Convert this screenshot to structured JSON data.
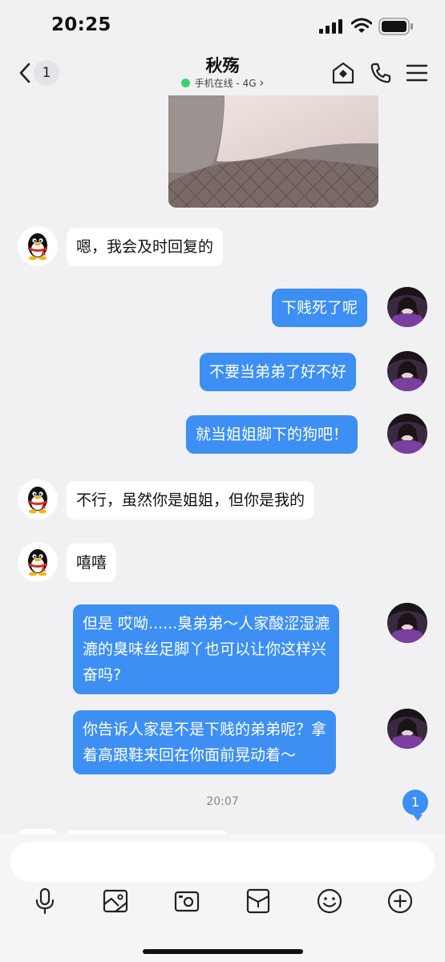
{
  "status_bar": {
    "time": "20:25"
  },
  "header": {
    "back_count": "1",
    "contact_name": "秋殇",
    "status_text": "手机在线 - 4G",
    "status_chevron": "›"
  },
  "messages": [
    {
      "side": "in",
      "text": "嗯，我会及时回复的"
    },
    {
      "side": "out",
      "text": "下贱死了呢"
    },
    {
      "side": "out",
      "text": "不要当弟弟了好不好"
    },
    {
      "side": "out",
      "text": "就当姐姐脚下的狗吧！"
    },
    {
      "side": "in",
      "text": "不行，虽然你是姐姐，但你是我的"
    },
    {
      "side": "in",
      "text": "嘻嘻"
    },
    {
      "side": "out",
      "lines": [
        "但是 哎呦......臭弟弟～人家酸涩湿漉",
        "漉的臭味丝足脚丫也可以让你这样兴",
        "奋吗?"
      ]
    },
    {
      "side": "out",
      "lines": [
        "你告诉人家是不是下贱的弟弟呢？拿",
        "着高跟鞋来回在你面前晃动着～"
      ]
    }
  ],
  "timestamp": "20:07",
  "new_message_count": "1",
  "composer": {
    "placeholder": "",
    "value": ""
  },
  "icons": {
    "header": [
      "back-chevron-icon",
      "home-shield-icon",
      "phone-icon",
      "menu-icon"
    ],
    "toolbar": [
      "microphone-icon",
      "image-icon",
      "camera-icon",
      "red-packet-icon",
      "emoji-icon",
      "plus-icon"
    ]
  },
  "colors": {
    "outgoing_bubble": "#3d8ff3",
    "incoming_bubble": "#ffffff",
    "online_dot": "#3cd070",
    "background": "#f1f1f3"
  }
}
